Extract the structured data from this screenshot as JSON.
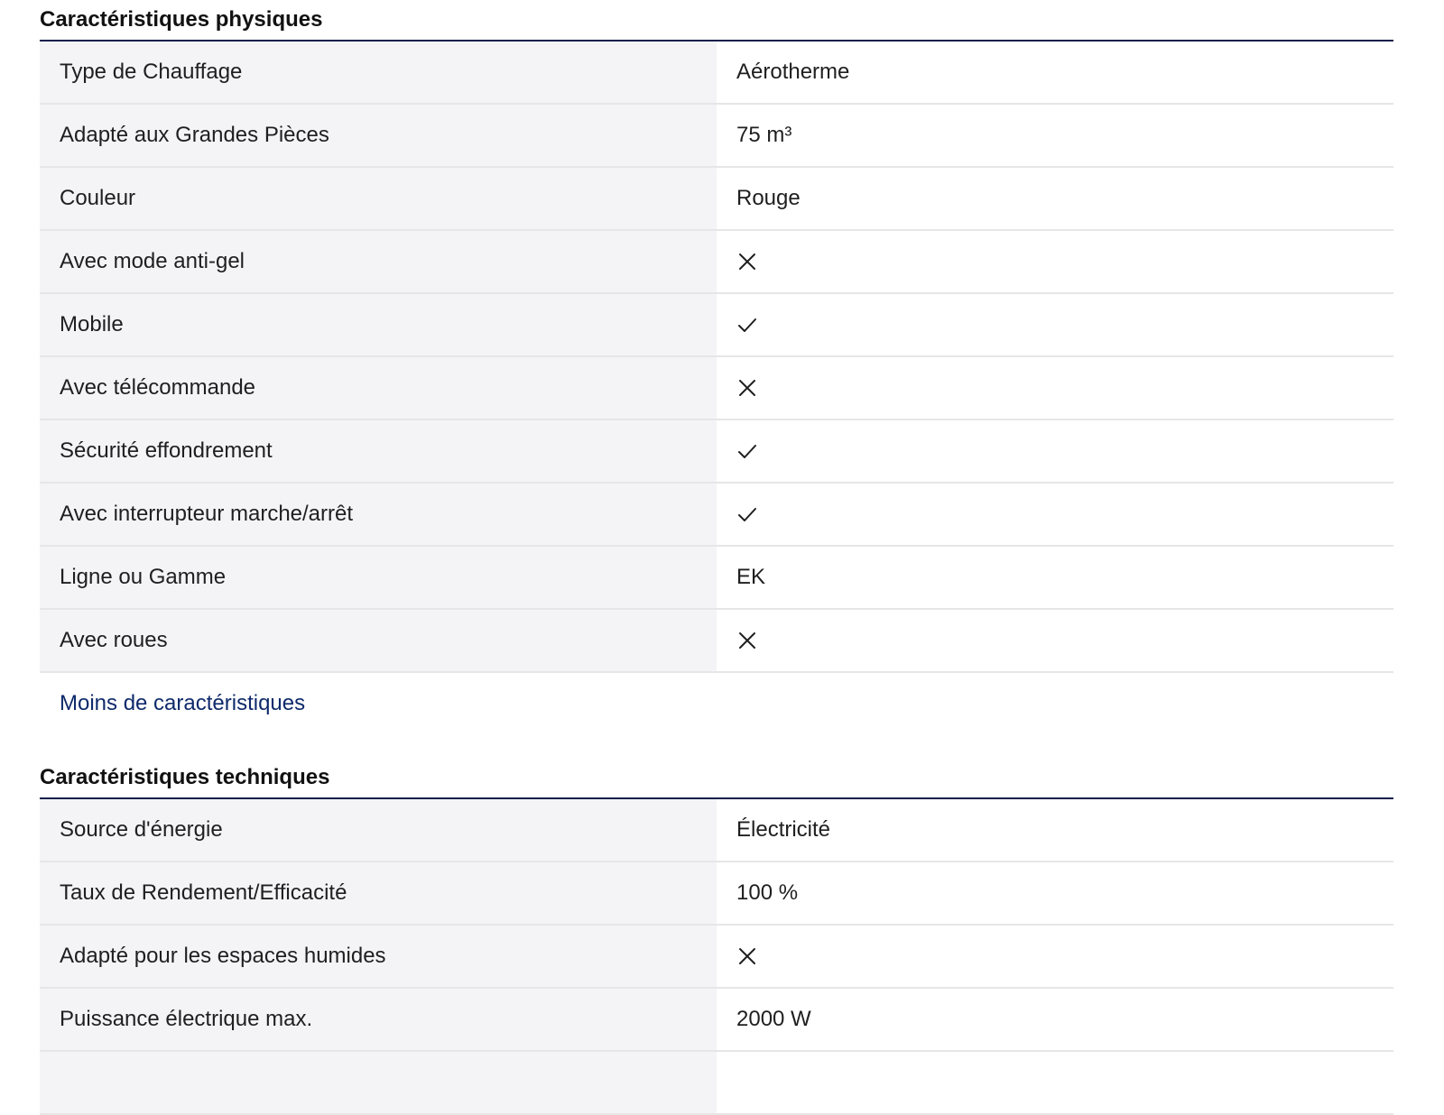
{
  "sections": [
    {
      "title": "Caractéristiques physiques",
      "rows": [
        {
          "label": "Type de Chauffage",
          "value": "Aérotherme"
        },
        {
          "label": "Adapté aux Grandes Pièces",
          "value": "75 m³"
        },
        {
          "label": "Couleur",
          "value": "Rouge"
        },
        {
          "label": "Avec mode anti-gel",
          "icon": "cross-icon"
        },
        {
          "label": "Mobile",
          "icon": "check-icon"
        },
        {
          "label": "Avec télécommande",
          "icon": "cross-icon"
        },
        {
          "label": "Sécurité effondrement",
          "icon": "check-icon"
        },
        {
          "label": "Avec interrupteur marche/arrêt",
          "icon": "check-icon"
        },
        {
          "label": "Ligne ou Gamme",
          "value": "EK"
        },
        {
          "label": "Avec roues",
          "icon": "cross-icon"
        }
      ],
      "link": "Moins de caractéristiques"
    },
    {
      "title": "Caractéristiques techniques",
      "rows": [
        {
          "label": "Source d'énergie",
          "value": "Électricité"
        },
        {
          "label": "Taux de Rendement/Efficacité",
          "value": "100 %"
        },
        {
          "label": "Adapté pour les espaces humides",
          "icon": "cross-icon"
        },
        {
          "label": "Puissance électrique max.",
          "value": "2000 W"
        }
      ]
    }
  ],
  "colors": {
    "accent": "#0f1f4a",
    "link": "#0f2a6b",
    "label_bg": "#f4f4f7",
    "divider": "#e6e6e6"
  }
}
